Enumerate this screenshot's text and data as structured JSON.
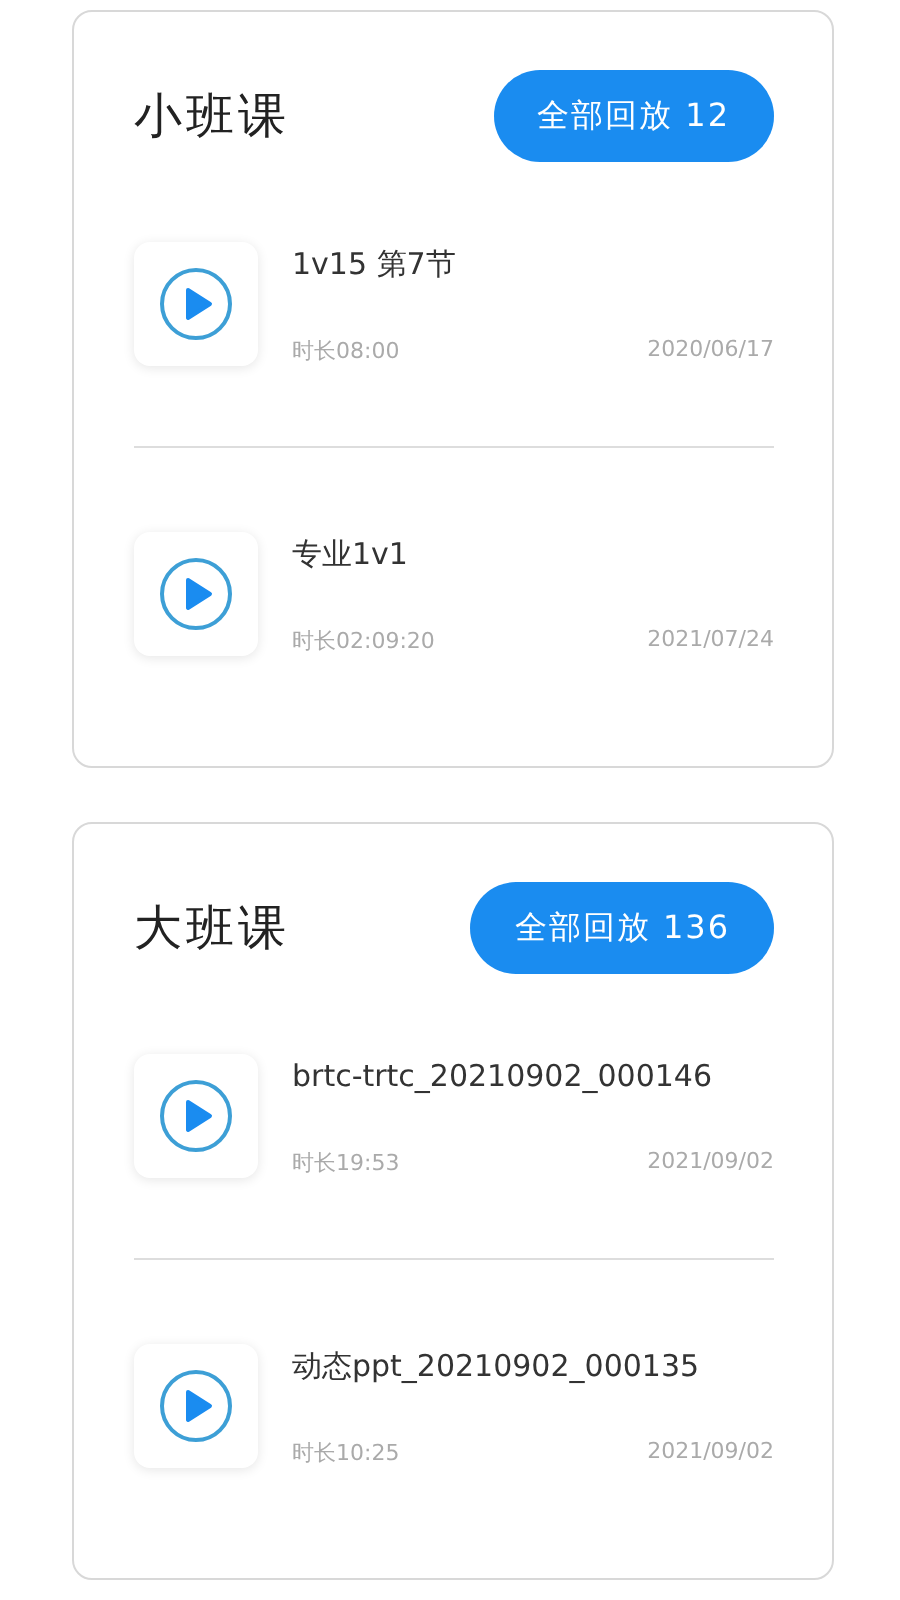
{
  "sections": [
    {
      "title": "小班课",
      "button": "全部回放 12",
      "videos": [
        {
          "title": "1v15 第7节",
          "duration": "时长08:00",
          "date": "2020/06/17"
        },
        {
          "title": "专业1v1",
          "duration": "时长02:09:20",
          "date": "2021/07/24"
        }
      ]
    },
    {
      "title": "大班课",
      "button": "全部回放 136",
      "videos": [
        {
          "title": "brtc-trtc_20210902_000146",
          "duration": "时长19:53",
          "date": "2021/09/02"
        },
        {
          "title": "动态ppt_20210902_000135",
          "duration": "时长10:25",
          "date": "2021/09/02"
        }
      ]
    }
  ]
}
